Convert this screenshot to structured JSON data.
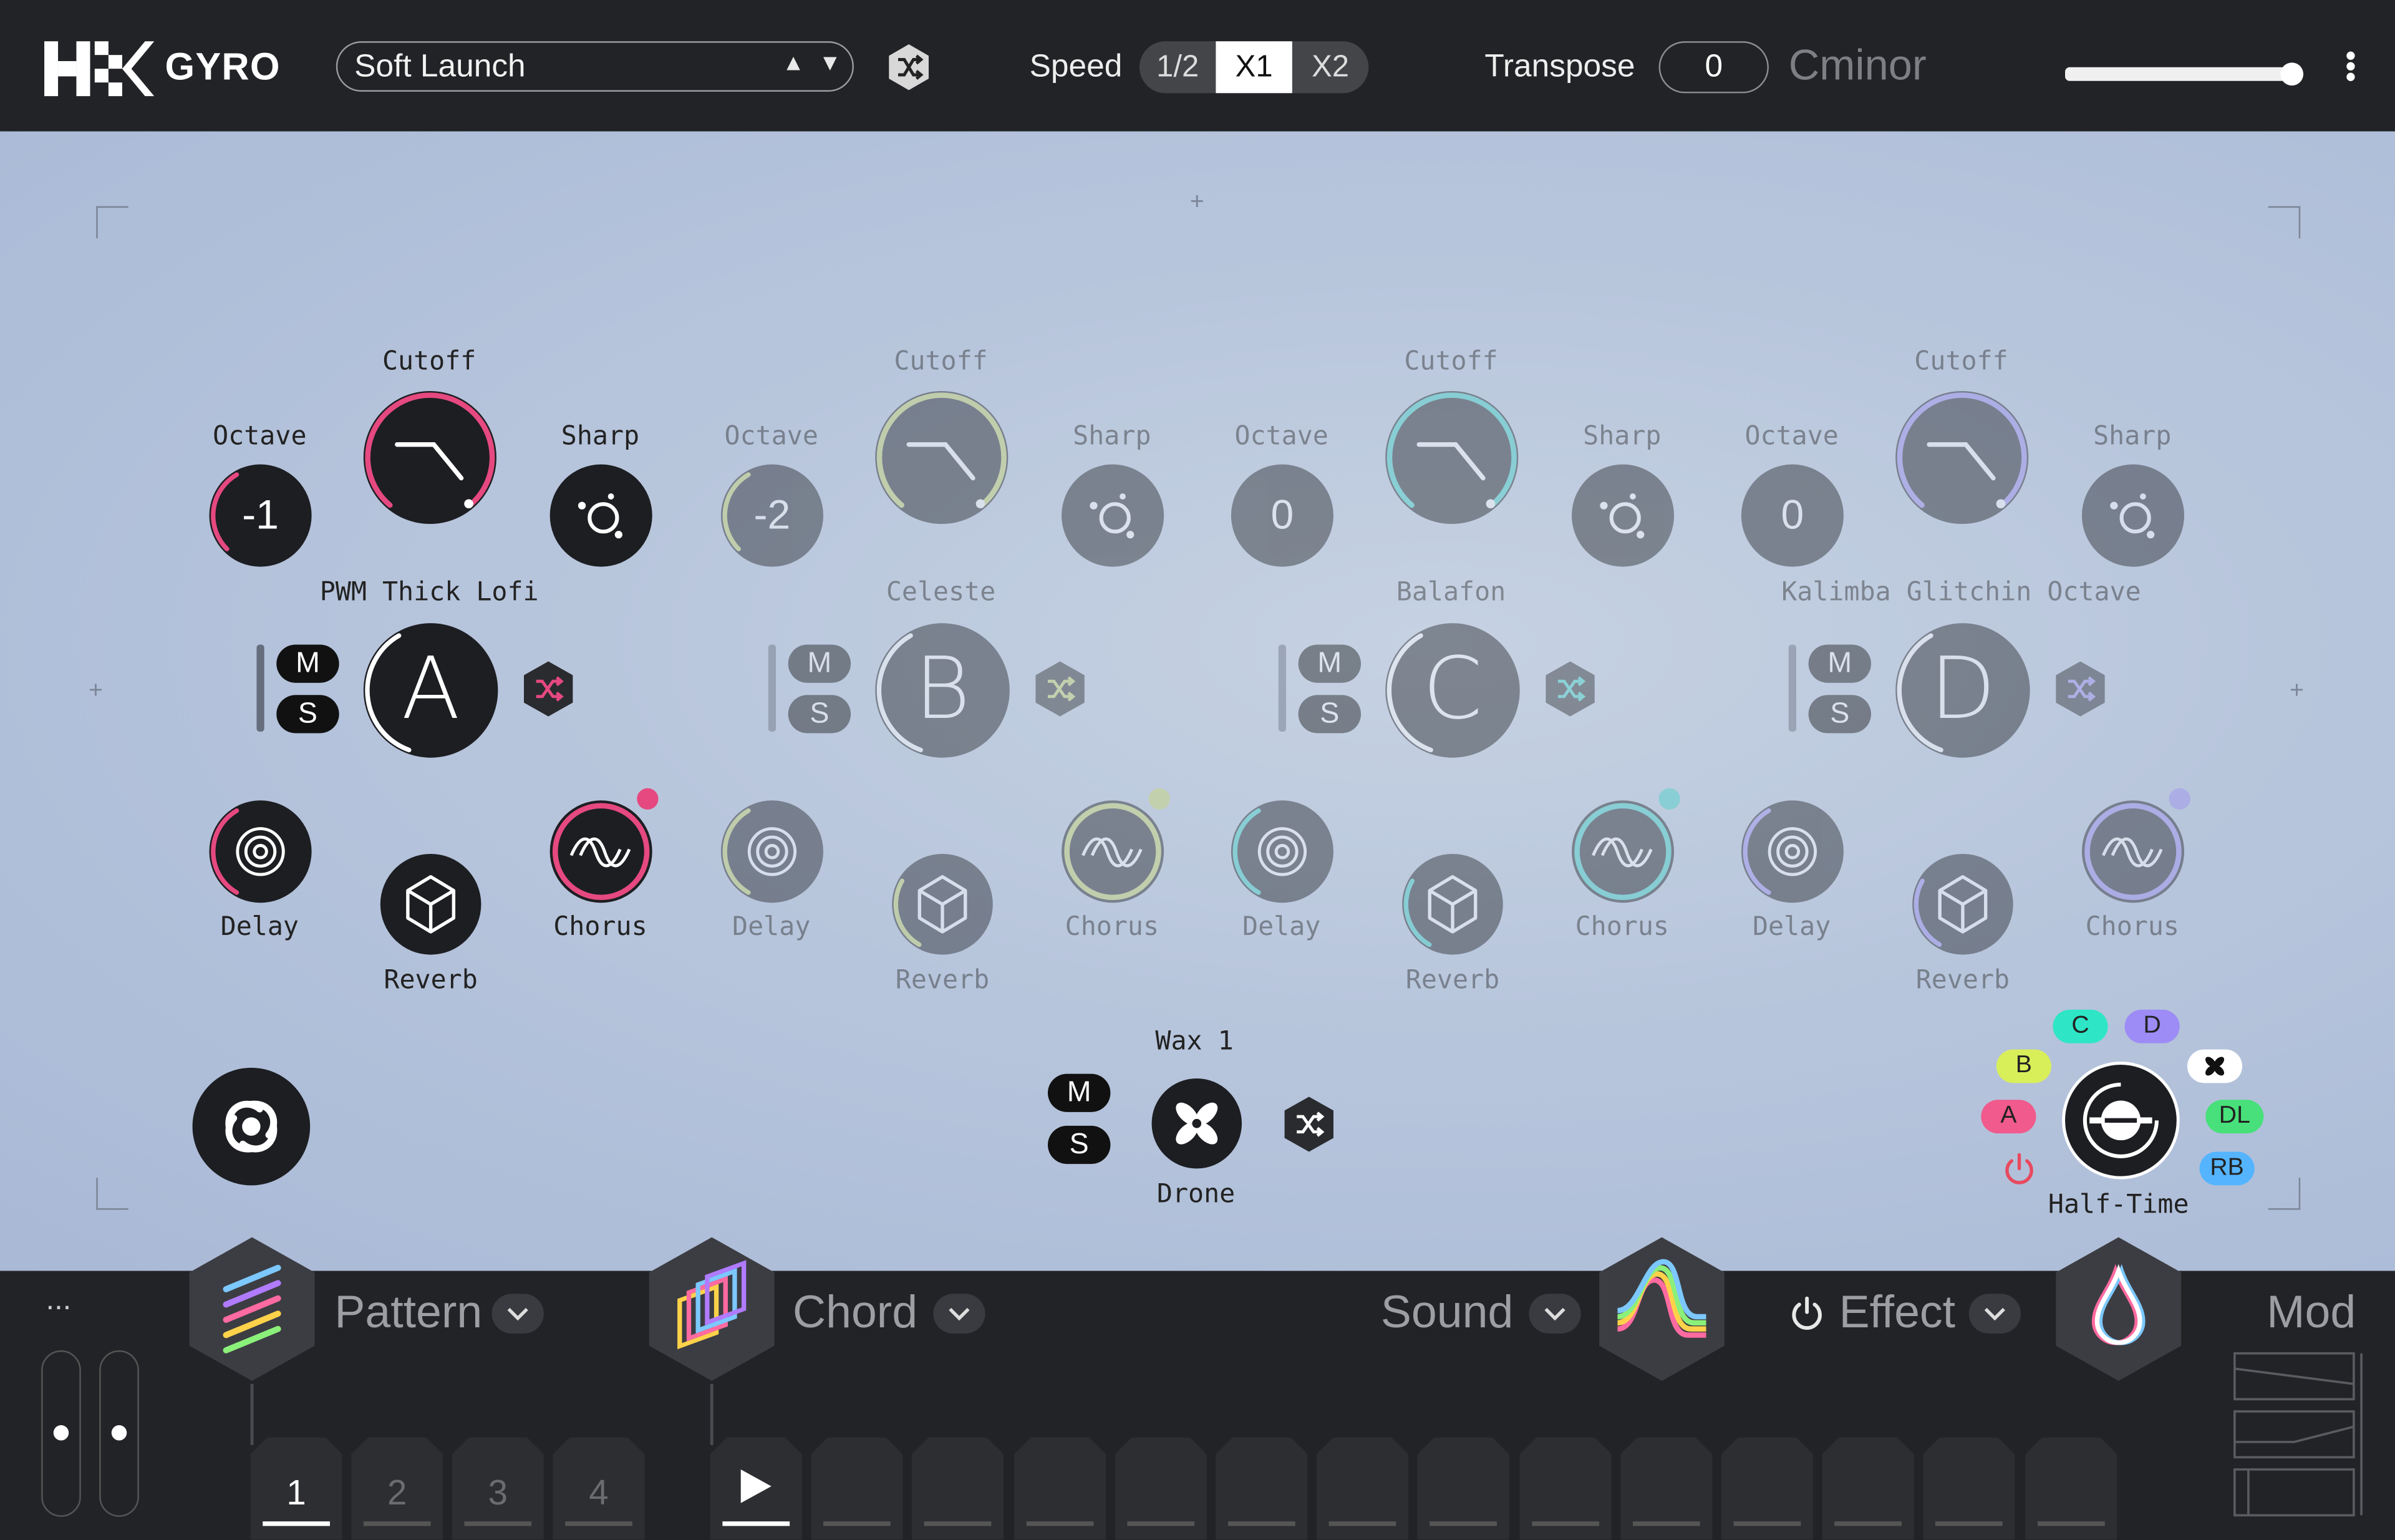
{
  "app": {
    "name": "GYRO",
    "logo_icon": "hk-logo-icon"
  },
  "header": {
    "preset": {
      "name": "Soft Launch",
      "up": "▲",
      "down": "▼"
    },
    "speed": {
      "label": "Speed",
      "options": [
        "1/2",
        "X1",
        "X2"
      ],
      "selected": "X1"
    },
    "transpose": {
      "label": "Transpose",
      "value": "0"
    },
    "key": "Cminor",
    "volume": 1.0
  },
  "layers": [
    {
      "id": "A",
      "sound": "PWM Thick Lofi",
      "octave": "-1",
      "accent": "#e5497f",
      "labels": {
        "cutoff": "Cutoff",
        "octave": "Octave",
        "sharp": "Sharp",
        "delay": "Delay",
        "reverb": "Reverb",
        "chorus": "Chorus"
      },
      "mute": "M",
      "solo": "S"
    },
    {
      "id": "B",
      "sound": "Celeste",
      "octave": "-2",
      "accent": "#c8d66a",
      "labels": {
        "cutoff": "Cutoff",
        "octave": "Octave",
        "sharp": "Sharp",
        "delay": "Delay",
        "reverb": "Reverb",
        "chorus": "Chorus"
      },
      "mute": "M",
      "solo": "S"
    },
    {
      "id": "C",
      "sound": "Balafon",
      "octave": "0",
      "accent": "#3fd3c6",
      "labels": {
        "cutoff": "Cutoff",
        "octave": "Octave",
        "sharp": "Sharp",
        "delay": "Delay",
        "reverb": "Reverb",
        "chorus": "Chorus"
      },
      "mute": "M",
      "solo": "S"
    },
    {
      "id": "D",
      "sound": "Kalimba Glitchin Octave",
      "octave": "0",
      "accent": "#9a8cf0",
      "labels": {
        "cutoff": "Cutoff",
        "octave": "Octave",
        "sharp": "Sharp",
        "delay": "Delay",
        "reverb": "Reverb",
        "chorus": "Chorus"
      },
      "mute": "M",
      "solo": "S"
    }
  ],
  "drone": {
    "name": "Wax 1",
    "label": "Drone",
    "mute": "M",
    "solo": "S"
  },
  "effect_router": {
    "label": "Half-Time",
    "pills": [
      {
        "text": "C",
        "color": "#2ee6c5"
      },
      {
        "text": "D",
        "color": "#9d8cf5"
      },
      {
        "text": "B",
        "color": "#d9ef5a"
      },
      {
        "text": "A",
        "color": "#f05a8c"
      },
      {
        "text": "DL",
        "color": "#47e07a"
      },
      {
        "text": "RB",
        "color": "#55b4ff"
      }
    ]
  },
  "bottom": {
    "menu": "...",
    "sections": {
      "pattern": "Pattern",
      "chord": "Chord",
      "sound": "Sound",
      "effect": "Effect",
      "mod": "Mod"
    },
    "pattern_steps": [
      "1",
      "2",
      "3",
      "4"
    ],
    "selected_pattern": "1"
  }
}
